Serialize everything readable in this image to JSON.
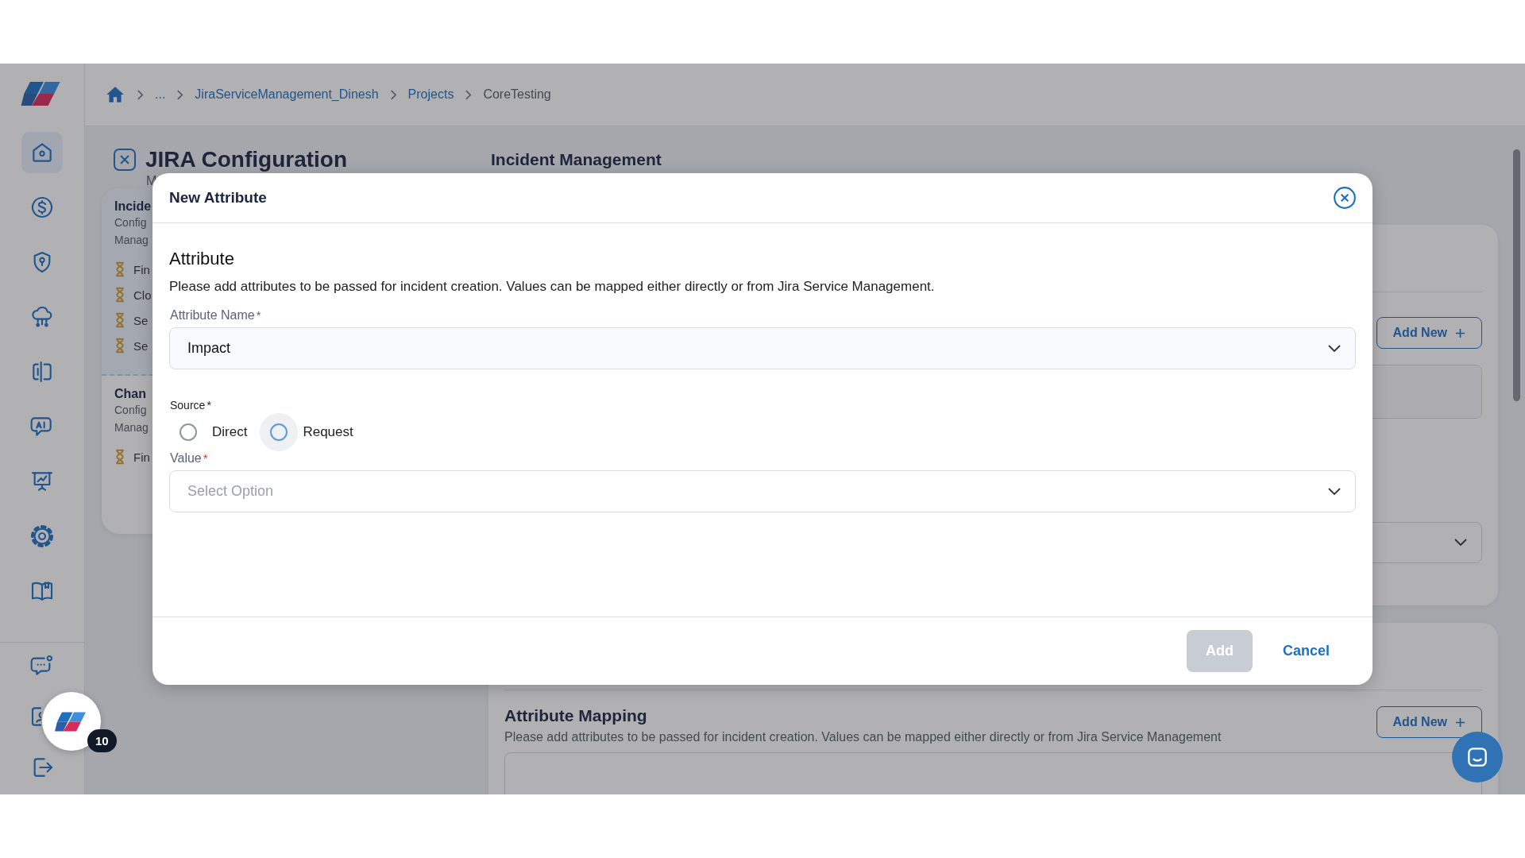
{
  "sidebar": {
    "items": [
      {
        "selected": true
      },
      {
        "selected": false
      },
      {
        "selected": false
      },
      {
        "selected": false
      },
      {
        "selected": false
      },
      {
        "selected": false
      },
      {
        "selected": false
      },
      {
        "selected": false
      },
      {
        "selected": false
      }
    ],
    "bottom_items": [
      {
        "selected": false
      },
      {
        "selected": false
      },
      {
        "selected": false
      }
    ]
  },
  "breadcrumb": [
    {
      "label": "...",
      "current": false
    },
    {
      "label": "JiraServiceManagement_Dinesh",
      "current": false
    },
    {
      "label": "Projects",
      "current": false
    },
    {
      "label": "CoreTesting",
      "current": true
    }
  ],
  "page": {
    "title": "JIRA Configuration",
    "subtitle": "M"
  },
  "left_panel": {
    "sections": [
      {
        "title": "Incide",
        "lines": [
          "Config",
          "Manag"
        ],
        "selected": true,
        "steps": [
          "Fin",
          "Clo",
          "Se",
          "Se"
        ]
      },
      {
        "title": "Chan",
        "lines": [
          "Config",
          "Manag"
        ],
        "selected": false,
        "steps": [
          "Fin"
        ]
      }
    ]
  },
  "main": {
    "heading": "Incident Management",
    "add_new": "Add New",
    "attribute_mapping": {
      "title": "Attribute Mapping",
      "description": "Please add attributes to be passed for incident creation. Values can be mapped either directly or from Jira Service Management",
      "add_new": "Add New"
    }
  },
  "modal": {
    "title": "New Attribute",
    "section_title": "Attribute",
    "description": "Please add attributes to be passed for incident creation. Values can be mapped either directly or from Jira Service Management.",
    "attribute_name": {
      "label": "Attribute Name",
      "required_mark": "*",
      "value": "Impact"
    },
    "source": {
      "label": "Source",
      "required_mark": "*",
      "options": [
        {
          "label": "Direct",
          "selected": false,
          "hovered": false
        },
        {
          "label": "Request",
          "selected": false,
          "hovered": true
        }
      ]
    },
    "value": {
      "label": "Value",
      "required_mark": "*",
      "placeholder": "Select Option"
    },
    "buttons": [
      {
        "label": "Add",
        "kind": "primary",
        "disabled": true
      },
      {
        "label": "Cancel",
        "kind": "link",
        "disabled": false
      }
    ]
  },
  "assistant": {
    "badge": "10"
  }
}
